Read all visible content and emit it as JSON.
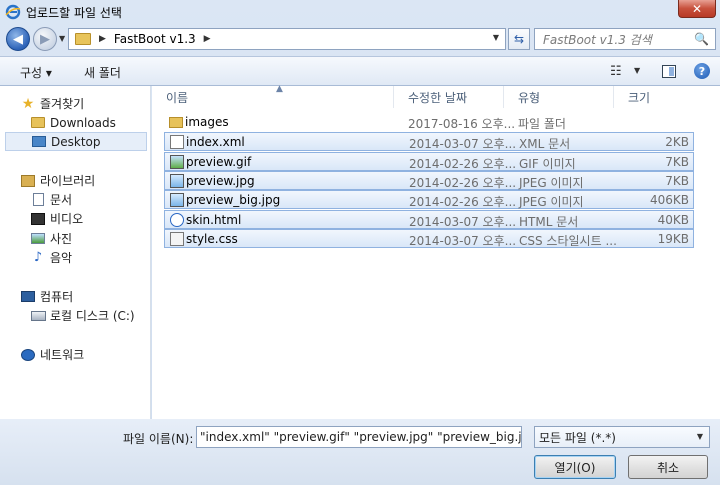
{
  "window": {
    "title": "업로드할 파일 선택",
    "close_label": "✕"
  },
  "address": {
    "path": "FastBoot v1.3",
    "search_placeholder": "FastBoot v1.3 검색"
  },
  "toolbar": {
    "organize": "구성 ▾",
    "new_folder": "새 폴더",
    "help": "?"
  },
  "sidebar": {
    "favorites": "즐겨찾기",
    "items": [
      "Downloads",
      "Desktop"
    ],
    "libraries": "라이브러리",
    "lib_items": [
      "문서",
      "비디오",
      "사진",
      "음악"
    ],
    "computer": "컴퓨터",
    "computer_items": [
      "로컬 디스크 (C:)"
    ],
    "network": "네트워크"
  },
  "columns": {
    "name": "이름",
    "modified": "수정한 날짜",
    "type": "유형",
    "size": "크기"
  },
  "files": [
    {
      "name": "images",
      "modified": "2017-08-16 오후...",
      "type": "파일 폴더",
      "size": ""
    },
    {
      "name": "index.xml",
      "modified": "2014-03-07 오후...",
      "type": "XML 문서",
      "size": "2KB"
    },
    {
      "name": "preview.gif",
      "modified": "2014-02-26 오후...",
      "type": "GIF 이미지",
      "size": "7KB"
    },
    {
      "name": "preview.jpg",
      "modified": "2014-02-26 오후...",
      "type": "JPEG 이미지",
      "size": "7KB"
    },
    {
      "name": "preview_big.jpg",
      "modified": "2014-02-26 오후...",
      "type": "JPEG 이미지",
      "size": "406KB"
    },
    {
      "name": "skin.html",
      "modified": "2014-03-07 오후...",
      "type": "HTML 문서",
      "size": "40KB"
    },
    {
      "name": "style.css",
      "modified": "2014-03-07 오후...",
      "type": "CSS 스타일시트 ...",
      "size": "19KB"
    }
  ],
  "bottom": {
    "filename_label": "파일 이름(N):",
    "filename_value": "\"index.xml\" \"preview.gif\" \"preview.jpg\" \"preview_big.jpg\" \"skin",
    "filetype": "모든 파일 (*.*)",
    "open": "열기(O)",
    "cancel": "취소"
  }
}
